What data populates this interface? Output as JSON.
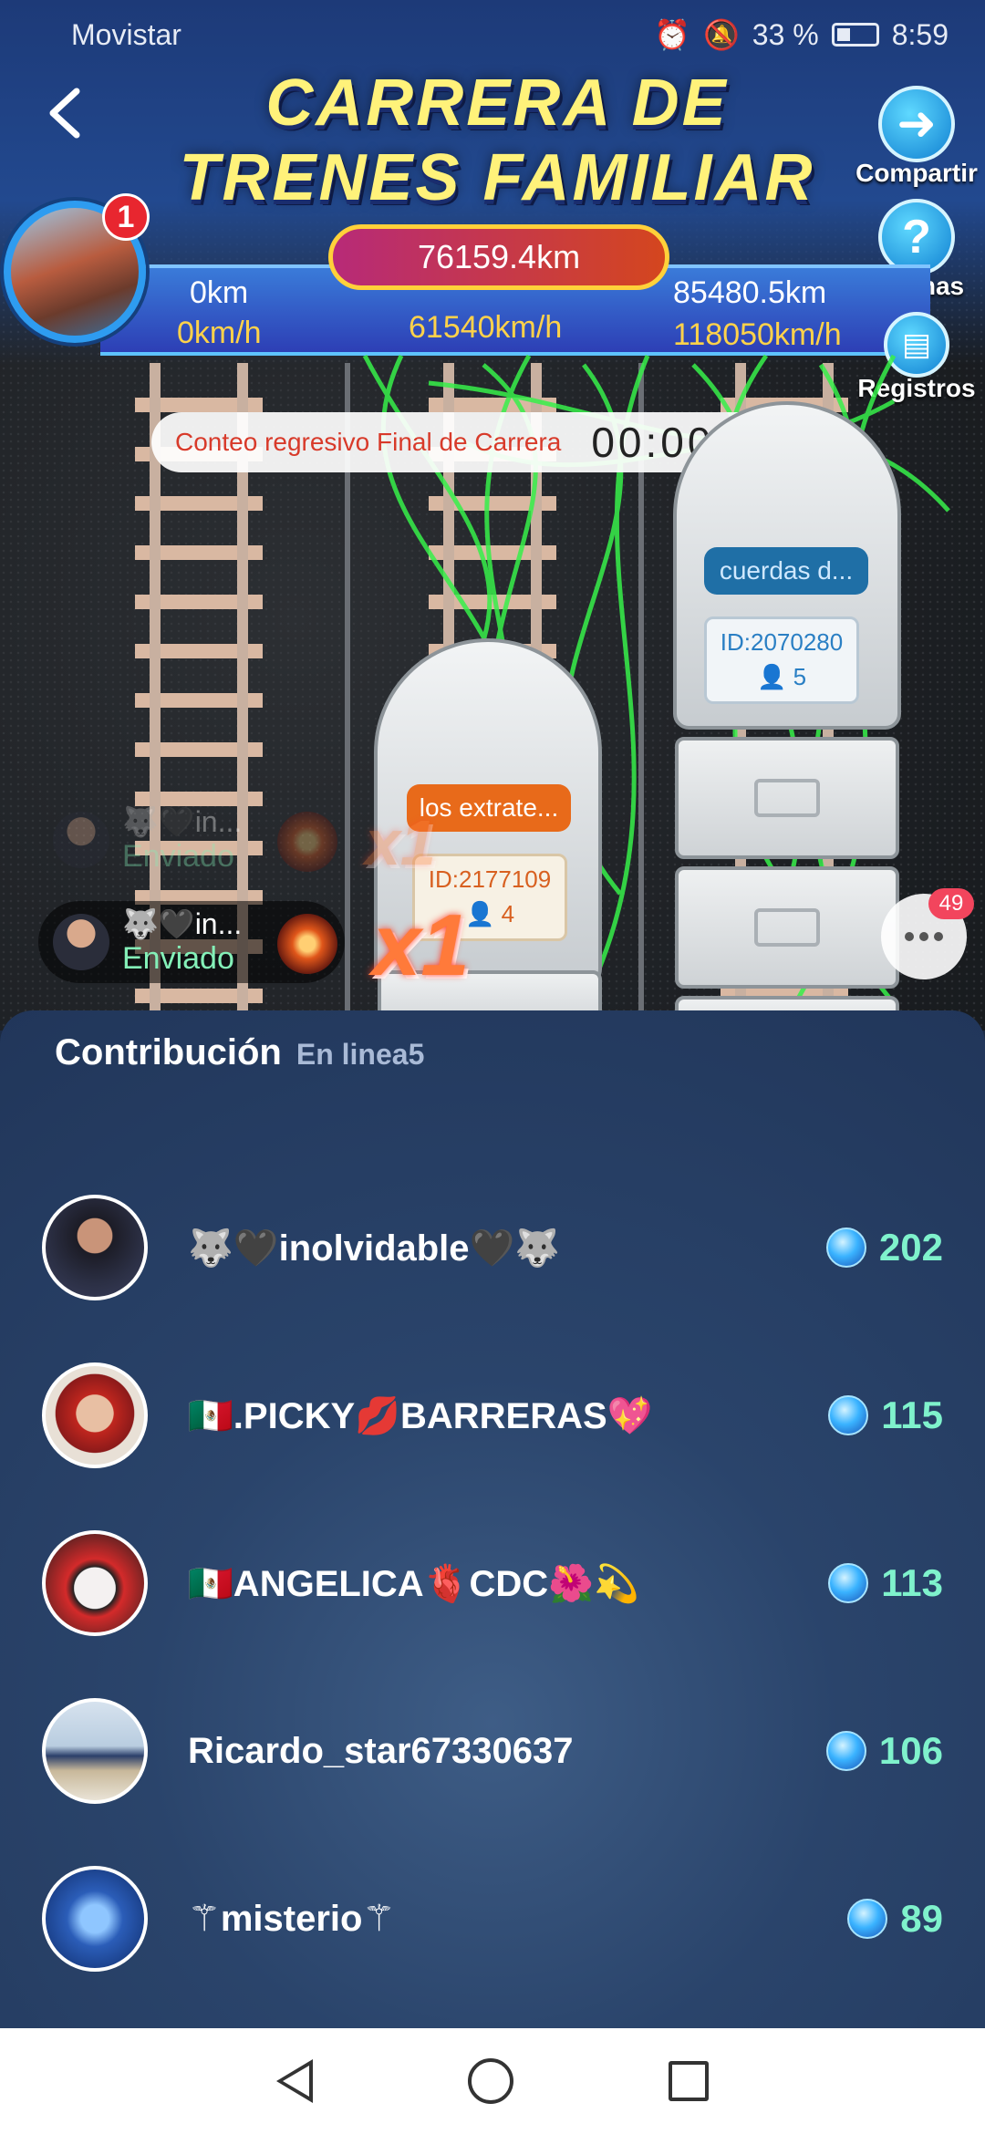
{
  "status_bar": {
    "carrier": "Movistar",
    "battery": "33 %",
    "time": "8:59"
  },
  "game": {
    "title_line1": "CARRERA DE",
    "title_line2": "TRENES FAMILIAR",
    "share_label": "Compartir",
    "rules_label": "Normas",
    "records_label": "Registros",
    "notification_count": "1",
    "distance_total": "76159.4km",
    "left_distance": "0km",
    "left_speed": "0km/h",
    "center_speed": "61540km/h",
    "right_distance": "85480.5km",
    "right_speed": "118050km/h",
    "countdown_label": "Conteo regresivo Final de Carrera",
    "countdown_time": "00:00:11",
    "train_center": {
      "name": "los extrate...",
      "id": "ID:2177109",
      "members": "4"
    },
    "train_right": {
      "name": "cuerdas d...",
      "id": "ID:2070280",
      "members": "5"
    },
    "multiplier": "x1",
    "gift_message": {
      "user": "🐺🖤in...",
      "status": "Enviado"
    },
    "chat_badge": "49"
  },
  "contribution": {
    "title": "Contribución",
    "online_label": "En linea5",
    "rows": [
      {
        "name": "🐺🖤inolvidable🖤🐺",
        "value": "202"
      },
      {
        "name": "🇲🇽.PICKY💋BARRERAS💖",
        "value": "115"
      },
      {
        "name": "🇲🇽ANGELICA🫀CDC🌺💫",
        "value": "113"
      },
      {
        "name": "Ricardo_star67330637",
        "value": "106"
      },
      {
        "name": "⚚misterio⚚",
        "value": "89"
      }
    ]
  },
  "colors": {
    "accent_green": "#7ff2cc",
    "title_yellow": "#fff27a",
    "countdown_red": "#d83a2a"
  }
}
